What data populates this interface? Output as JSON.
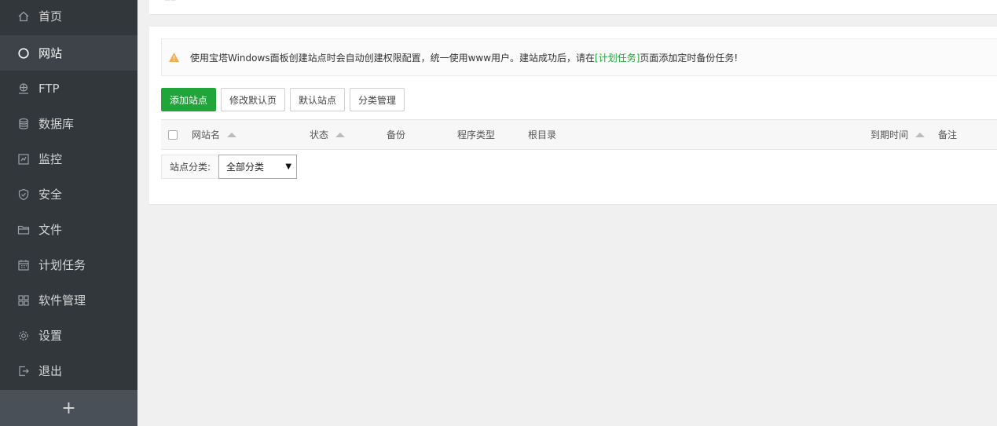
{
  "sidebar": {
    "items": [
      {
        "label": "首页",
        "icon": "home-icon"
      },
      {
        "label": "网站",
        "icon": "globe-icon",
        "active": true
      },
      {
        "label": "FTP",
        "icon": "ftp-icon"
      },
      {
        "label": "数据库",
        "icon": "database-icon"
      },
      {
        "label": "监控",
        "icon": "monitor-icon"
      },
      {
        "label": "安全",
        "icon": "shield-icon"
      },
      {
        "label": "文件",
        "icon": "folder-icon"
      },
      {
        "label": "计划任务",
        "icon": "calendar-icon"
      },
      {
        "label": "软件管理",
        "icon": "apps-icon"
      },
      {
        "label": "设置",
        "icon": "gear-icon"
      },
      {
        "label": "退出",
        "icon": "logout-icon"
      }
    ],
    "add_label": "+"
  },
  "notice": {
    "text_before": "使用宝塔Windows面板创建站点时会自动创建权限配置，统一使用www用户。建站成功后，请在",
    "link": "[计划任务]",
    "text_after": "页面添加定时备份任务!"
  },
  "toolbar": {
    "add_site": "添加站点",
    "edit_default_page": "修改默认页",
    "default_site": "默认站点",
    "category_manage": "分类管理"
  },
  "table": {
    "columns": {
      "site_name": "网站名",
      "status": "状态",
      "backup": "备份",
      "program_type": "程序类型",
      "root_dir": "根目录",
      "expire_time": "到期时间",
      "remark": "备注"
    }
  },
  "filter": {
    "label": "站点分类:",
    "selected": "全部分类",
    "arrow": "▼"
  },
  "colors": {
    "sidebar_bg": "#32373b",
    "accent": "#20a53a",
    "warning": "#f0ad4e"
  }
}
